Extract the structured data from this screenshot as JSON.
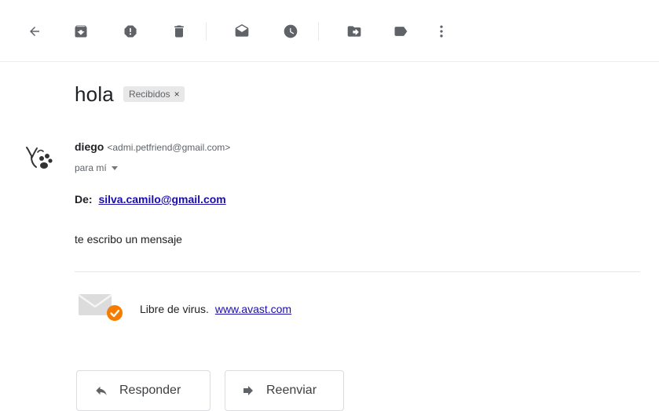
{
  "toolbar": {
    "icons": [
      "back-arrow-icon",
      "archive-icon",
      "report-spam-icon",
      "delete-icon",
      "mark-unread-icon",
      "snooze-icon",
      "move-to-icon",
      "label-icon",
      "more-vert-icon"
    ]
  },
  "email": {
    "subject": "hola",
    "label_chip": "Recibidos",
    "label_remove": "×",
    "sender_name": "diego",
    "sender_email": "<admi.petfriend@gmail.com>",
    "to_text": "para mí",
    "body_from_label": "De:",
    "body_from_email": "silva.camilo@gmail.com",
    "body_message": "te escribo un mensaje",
    "avast_text": "Libre de virus.",
    "avast_link": "www.avast.com"
  },
  "actions": {
    "reply_label": "Responder",
    "forward_label": "Reenviar"
  },
  "colors": {
    "icon": "#5f6368",
    "link": "#1a0dab",
    "avast_badge": "#f57c00"
  }
}
